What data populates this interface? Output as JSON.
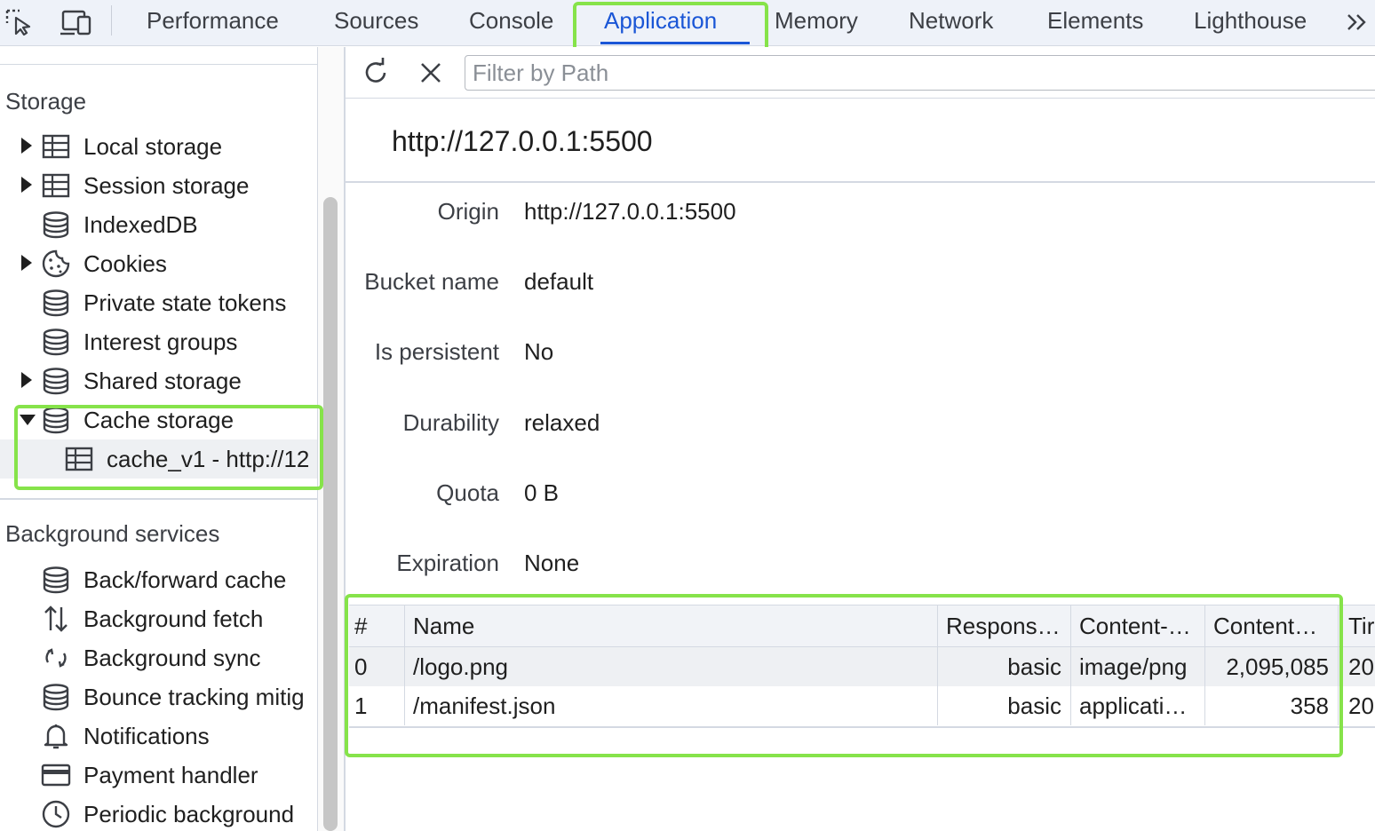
{
  "topbar": {
    "tools": [
      {
        "icon": "inspect-element-icon"
      },
      {
        "icon": "device-toolbar-icon"
      }
    ],
    "tabs": [
      {
        "label": "Performance",
        "active": false
      },
      {
        "label": "Sources",
        "active": false
      },
      {
        "label": "Console",
        "active": false
      },
      {
        "label": "Application",
        "active": true
      },
      {
        "label": "Memory",
        "active": false
      },
      {
        "label": "Network",
        "active": false
      },
      {
        "label": "Elements",
        "active": false
      },
      {
        "label": "Lighthouse",
        "active": false
      }
    ],
    "more_icon": "double-chevron-right-icon"
  },
  "sidebar": {
    "storage_title": "Storage",
    "storage_items": [
      {
        "label": "Local storage",
        "icon": "table-icon",
        "expandable": true,
        "expanded": false
      },
      {
        "label": "Session storage",
        "icon": "table-icon",
        "expandable": true,
        "expanded": false
      },
      {
        "label": "IndexedDB",
        "icon": "database-icon",
        "expandable": false
      },
      {
        "label": "Cookies",
        "icon": "cookie-icon",
        "expandable": true,
        "expanded": false
      },
      {
        "label": "Private state tokens",
        "icon": "database-icon",
        "expandable": false
      },
      {
        "label": "Interest groups",
        "icon": "database-icon",
        "expandable": false
      },
      {
        "label": "Shared storage",
        "icon": "database-icon",
        "expandable": true,
        "expanded": false
      },
      {
        "label": "Cache storage",
        "icon": "database-icon",
        "expandable": true,
        "expanded": true
      },
      {
        "label": "cache_v1 - http://12",
        "icon": "table-icon",
        "child": true,
        "selected": true
      }
    ],
    "background_title": "Background services",
    "background_items": [
      {
        "label": "Back/forward cache",
        "icon": "database-icon"
      },
      {
        "label": "Background fetch",
        "icon": "up-down-arrows-icon"
      },
      {
        "label": "Background sync",
        "icon": "sync-icon"
      },
      {
        "label": "Bounce tracking mitig",
        "icon": "database-icon"
      },
      {
        "label": "Notifications",
        "icon": "bell-icon"
      },
      {
        "label": "Payment handler",
        "icon": "credit-card-icon"
      },
      {
        "label": "Periodic background",
        "icon": "clock-icon"
      }
    ]
  },
  "toolbar": {
    "refresh_icon": "refresh-icon",
    "clear_icon": "close-icon",
    "filter_placeholder": "Filter by Path",
    "filter_value": ""
  },
  "details": {
    "origin_title": "http://127.0.0.1:5500",
    "fields": [
      {
        "key": "Origin",
        "value": "http://127.0.0.1:5500"
      },
      {
        "key": "Bucket name",
        "value": "default"
      },
      {
        "key": "Is persistent",
        "value": "No"
      },
      {
        "key": "Durability",
        "value": "relaxed"
      },
      {
        "key": "Quota",
        "value": "0 B"
      },
      {
        "key": "Expiration",
        "value": "None"
      }
    ]
  },
  "table": {
    "columns": [
      "#",
      "Name",
      "Respons…",
      "Content-…",
      "Content…",
      "Tir"
    ],
    "rows": [
      [
        "0",
        "/logo.png",
        "basic",
        "image/png",
        "2,095,085",
        "20"
      ],
      [
        "1",
        "/manifest.json",
        "basic",
        "applicati…",
        "358",
        "20"
      ]
    ]
  },
  "highlight_color": "#86e34a",
  "accent_color": "#1a56d6"
}
